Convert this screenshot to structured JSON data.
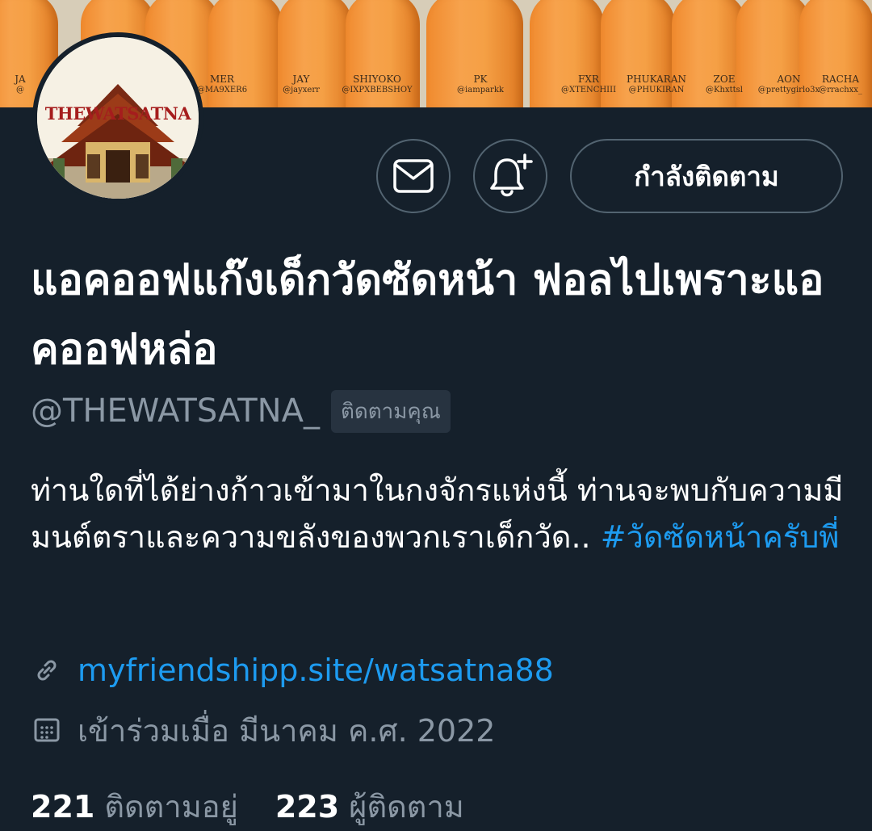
{
  "banner": {
    "tags": [
      {
        "name": "JA",
        "handle": "@"
      },
      {
        "name": "MER",
        "handle": "@MA9XER6"
      },
      {
        "name": "JAY",
        "handle": "@jayxerr"
      },
      {
        "name": "SHIYOKO",
        "handle": "@IXPXBEBSHOY"
      },
      {
        "name": "PK",
        "handle": "@iamparkk"
      },
      {
        "name": "FXR",
        "handle": "@XTENCHIII"
      },
      {
        "name": "PHUKARAN",
        "handle": "@PHUKIRAN"
      },
      {
        "name": "ZOE",
        "handle": "@Khxttsl"
      },
      {
        "name": "AON",
        "handle": "@prettygirlo3x"
      },
      {
        "name": "RACHA",
        "handle": "@rrachxx_"
      }
    ]
  },
  "avatar": {
    "title": "THEWATSATNA"
  },
  "actions": {
    "follow_label": "กำลังติดตาม",
    "message_icon": "envelope-icon",
    "notify_icon": "bell-plus-icon"
  },
  "profile": {
    "display_name": "แอคออฟแก๊งเด็กวัดซัดหน้า ฟอลไปเพราะแอคออฟหล่อ",
    "handle": "@THEWATSATNA_",
    "follows_you": "ติดตามคุณ",
    "bio_text": "ท่านใดที่ได้ย่างก้าวเข้ามาในกงจักรแห่งนี้ ท่านจะพบกับความมีมนต์ตราและความขลังของพวกเราเด็กวัด.. ",
    "bio_hashtag": "#วัดซัดหน้าครับพี่",
    "link": "myfriendshipp.site/watsatna88",
    "joined": "เข้าร่วมเมื่อ มีนาคม ค.ศ. 2022"
  },
  "stats": {
    "following_count": "221",
    "following_label": "ติดตามอยู่",
    "followers_count": "223",
    "followers_label": "ผู้ติดตาม"
  },
  "colors": {
    "background": "#15202b",
    "accent": "#1d9bf0",
    "secondary_text": "#8b98a5",
    "border": "#536471"
  }
}
